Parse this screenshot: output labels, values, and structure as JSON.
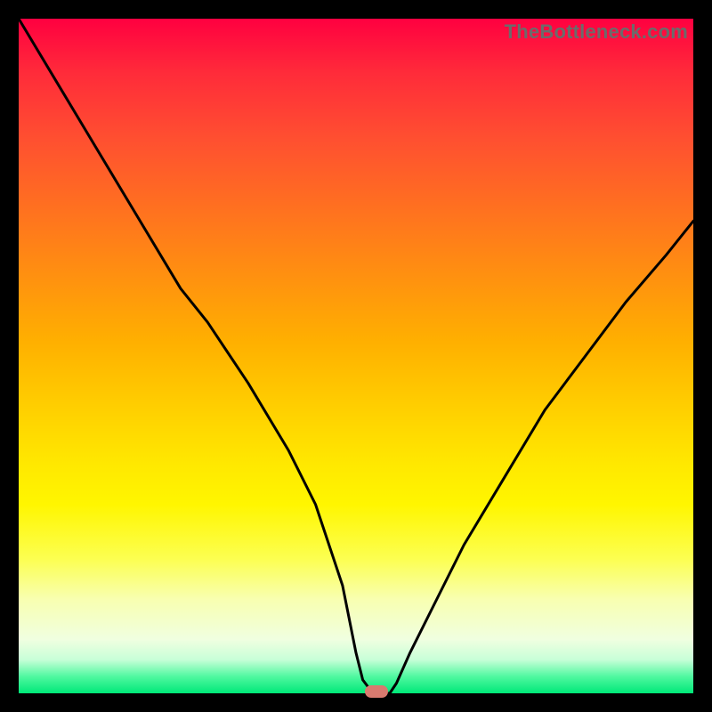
{
  "watermark": "TheBottleneck.com",
  "chart_data": {
    "type": "line",
    "title": "",
    "xlabel": "",
    "ylabel": "",
    "xlim": [
      0,
      100
    ],
    "ylim": [
      0,
      100
    ],
    "grid": false,
    "legend": false,
    "series": [
      {
        "name": "curve",
        "x": [
          0,
          6,
          12,
          18,
          24,
          28,
          34,
          40,
          44,
          48,
          50,
          51,
          52.5,
          54,
          55,
          56,
          58,
          62,
          66,
          72,
          78,
          84,
          90,
          96,
          100
        ],
        "y": [
          100,
          90,
          80,
          70,
          60,
          55,
          46,
          36,
          28,
          16,
          6,
          2,
          0,
          0,
          0,
          1.5,
          6,
          14,
          22,
          32,
          42,
          50,
          58,
          65,
          70
        ]
      }
    ],
    "marker": {
      "x": 53,
      "y": 0,
      "color": "#d87a6f"
    },
    "gradient_stops": [
      {
        "pct": 0,
        "color": "#ff0040"
      },
      {
        "pct": 50,
        "color": "#ffd000"
      },
      {
        "pct": 80,
        "color": "#fcff50"
      },
      {
        "pct": 100,
        "color": "#00e878"
      }
    ]
  }
}
